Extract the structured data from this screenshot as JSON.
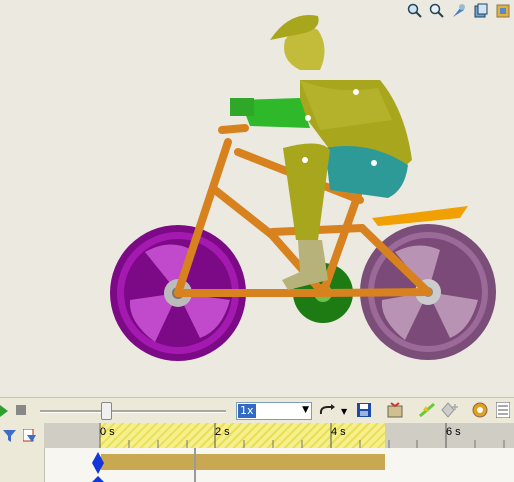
{
  "toolbar": {
    "speed_value": "1x",
    "slider_position": 0.35
  },
  "timeline": {
    "ruler_labels": [
      "0 s",
      "2 s",
      "4 s",
      "6 s"
    ],
    "marker_time": "0 s"
  },
  "colors": {
    "viewport_bg": "#ebe9e0",
    "front_wheel": "#9a1aa6",
    "rear_wheel": "#8c5e8a",
    "frame": "#d7821e",
    "gear": "#1e7a12",
    "rider_body": "#a8a61c",
    "rider_pants": "#2e9a98",
    "rider_arm": "#2fb82a",
    "timeline_highlight": "#f6f08a",
    "key_bar": "#c8a850",
    "key_marker": "#1438d8"
  },
  "icons": [
    "zoom-in-icon",
    "zoom-fit-icon",
    "zoom-area-icon",
    "view-orientation-icon",
    "display-style-icon"
  ]
}
